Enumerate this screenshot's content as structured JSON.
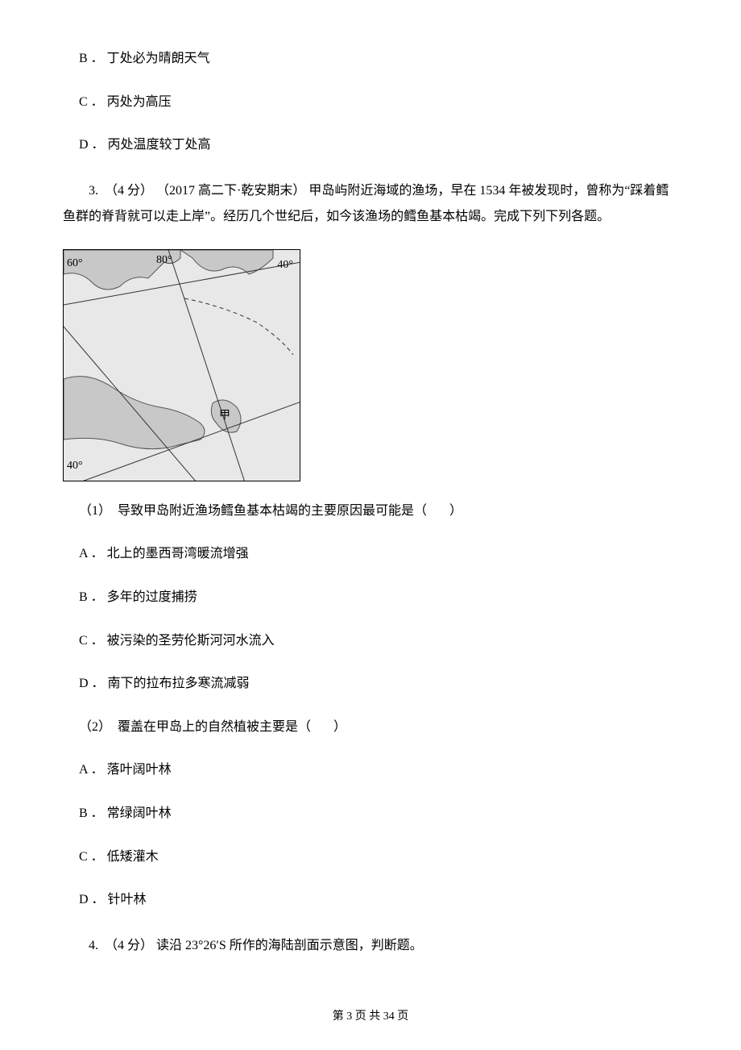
{
  "prev_options": {
    "b": "B ． 丁处必为晴朗天气",
    "c": "C ． 丙处为高压",
    "d": "D ． 丙处温度较丁处高"
  },
  "q3": {
    "intro": "3.  （4 分） （2017 高二下·乾安期末） 甲岛屿附近海域的渔场，早在 1534 年被发现时，曾称为“踩着鳕鱼群的脊背就可以走上岸”。经历几个世纪后，如今该渔场的鳕鱼基本枯竭。完成下列下列各题。",
    "map_labels": {
      "tl": "60°",
      "tc": "80°",
      "tr": "40°",
      "jia": "甲",
      "bl": "40°"
    },
    "sub1": {
      "stem": "（1）  导致甲岛附近渔场鳕鱼基本枯竭的主要原因最可能是（       ）",
      "a": "A ． 北上的墨西哥湾暖流增强",
      "b": "B ． 多年的过度捕捞",
      "c": "C ． 被污染的圣劳伦斯河河水流入",
      "d": "D ． 南下的拉布拉多寒流减弱"
    },
    "sub2": {
      "stem": "（2）  覆盖在甲岛上的自然植被主要是（       ）",
      "a": "A ． 落叶阔叶林",
      "b": "B ． 常绿阔叶林",
      "c": "C ． 低矮灌木",
      "d": "D ． 针叶林"
    }
  },
  "q4": {
    "intro": "4.  （4 分） 读沿 23°26′S 所作的海陆剖面示意图，判断题。"
  },
  "footer": "第 3 页 共 34 页"
}
